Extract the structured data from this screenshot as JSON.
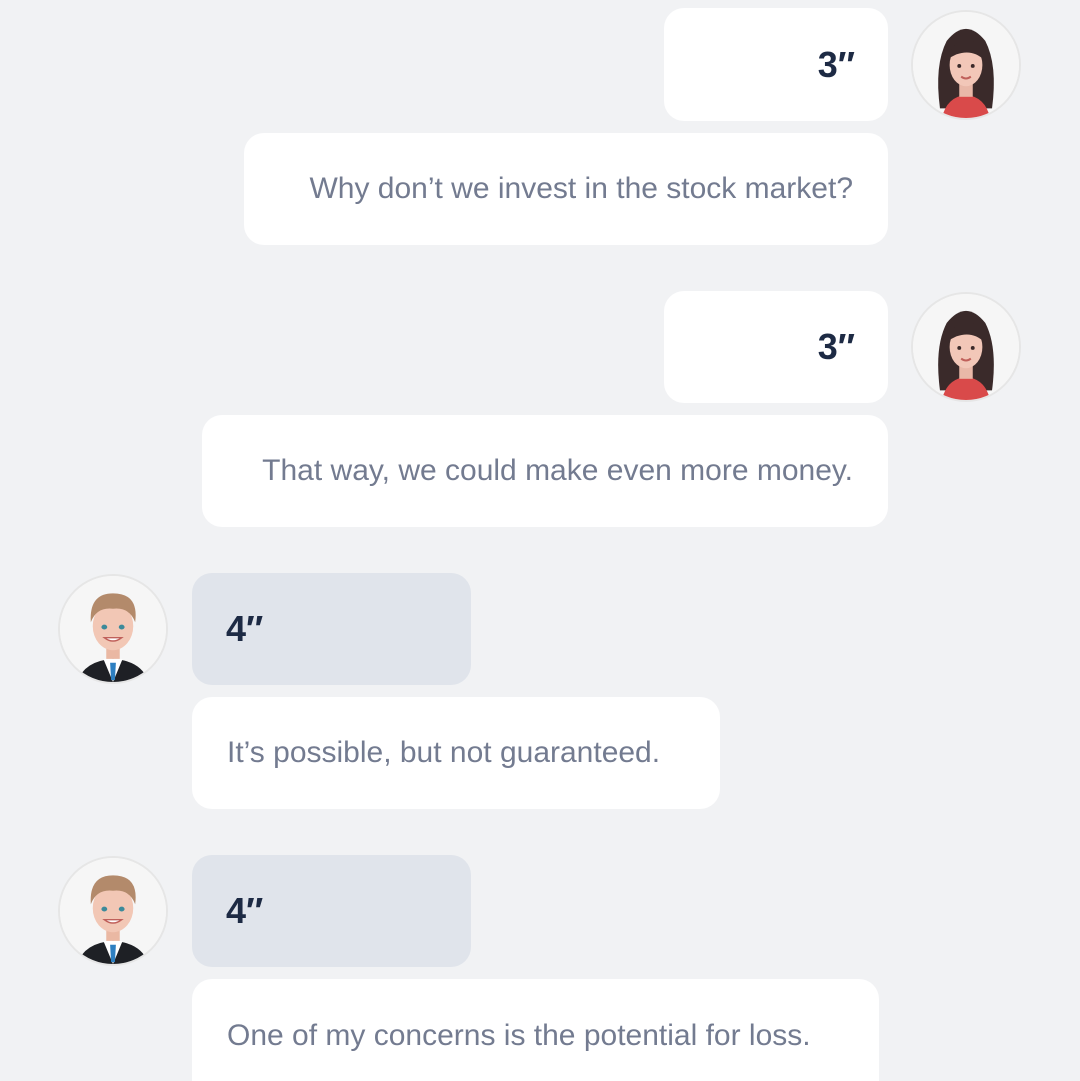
{
  "messages": [
    {
      "speaker": "woman",
      "side": "right",
      "duration": "3″",
      "text": "Why don’t we invest in the stock market?"
    },
    {
      "speaker": "woman",
      "side": "right",
      "duration": "3″",
      "text": "That way, we could make even more money."
    },
    {
      "speaker": "man",
      "side": "left",
      "duration": "4″",
      "text": "It’s possible, but not guaranteed."
    },
    {
      "speaker": "man",
      "side": "left",
      "duration": "4″",
      "text": "One of my concerns is the potential for loss."
    }
  ],
  "colors": {
    "background": "#f1f2f4",
    "bubble": "#ffffff",
    "left_duration_bubble": "#e0e4eb",
    "duration_text": "#1d2a44",
    "message_text": "#737b90"
  },
  "icons": {
    "woman_avatar": "woman-avatar-icon",
    "man_avatar": "man-avatar-icon"
  }
}
